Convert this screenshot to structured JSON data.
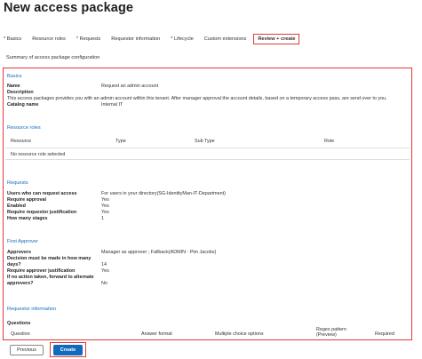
{
  "page": {
    "title": "New access package"
  },
  "tabs": [
    {
      "label": "* Basics"
    },
    {
      "label": "Resource roles"
    },
    {
      "label": "* Requests"
    },
    {
      "label": "Requestor information"
    },
    {
      "label": "* Lifecycle"
    },
    {
      "label": "Custom extensions"
    },
    {
      "label": "Review + create",
      "active": true
    }
  ],
  "summary_title": "Summary of access package configuration",
  "basics": {
    "heading": "Basics",
    "rows": [
      {
        "label": "Name",
        "value": "Request an admin account"
      },
      {
        "label": "Description",
        "value": ""
      },
      {
        "label": "Catalog name",
        "value": "Internal IT"
      }
    ],
    "description_text": "This access packages provides you with an admin account within this tenant. After manager approval the account details, based on a temporary access pass, are send over to you."
  },
  "resource_roles": {
    "heading": "Resource roles",
    "columns": [
      "Resource",
      "Type",
      "Sub Type",
      "Role"
    ],
    "empty_text": "No resource role selected"
  },
  "requests": {
    "heading": "Requests",
    "rows": [
      {
        "label": "Users who can request access",
        "value": "For users in your directory(SG-IdentityMan-IT-Department)"
      },
      {
        "label": "Require approval",
        "value": "Yes"
      },
      {
        "label": "Enabled",
        "value": "Yes"
      },
      {
        "label": "Require requestor justification",
        "value": "Yes"
      },
      {
        "label": "How many stages",
        "value": "1"
      }
    ]
  },
  "first_approver": {
    "heading": "First Approver",
    "approvers_label": "Approvers",
    "approvers_value": "Manager as approver ; Fallback(ADMIN - Pim Jacobs)",
    "decision_label_1": "Decision must be made in how many",
    "decision_label_2": "days?",
    "decision_value": "14",
    "justification_label": "Require approver justification",
    "justification_value": "Yes",
    "forward_label_1": "If no action taken, forward to alternate",
    "forward_label_2": "approvers?",
    "forward_value": "No"
  },
  "requestor_information": {
    "heading": "Requestor information",
    "questions_label": "Questions",
    "columns": [
      "Question",
      "Answer format",
      "Multiple choice options",
      "Regex pattern (Preview)",
      "Required"
    ]
  },
  "footer": {
    "previous_label": "Previous",
    "create_label": "Create"
  },
  "colors": {
    "accent": "#0f6cbd",
    "highlight": "#e23838"
  }
}
